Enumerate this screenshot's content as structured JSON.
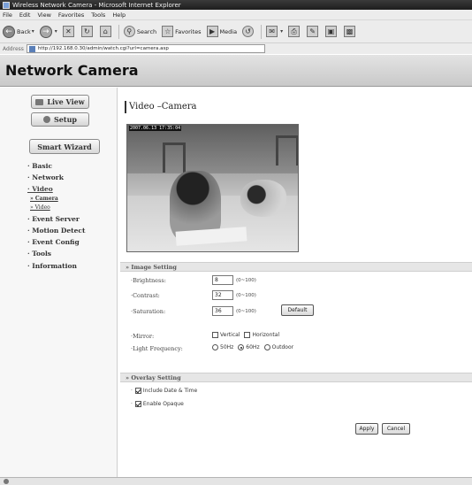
{
  "window": {
    "title": "Wireless Network Camera - Microsoft Internet Explorer"
  },
  "menu": [
    "File",
    "Edit",
    "View",
    "Favorites",
    "Tools",
    "Help"
  ],
  "toolbar": {
    "back_label": "Back",
    "search_label": "Search",
    "favorites_label": "Favorites",
    "media_label": "Media"
  },
  "address": {
    "label": "Address",
    "url": "http://192.168.0.30/admin/watch.cgi?url=camera.asp"
  },
  "header": {
    "brand": "Network Camera"
  },
  "sidebar": {
    "live_view": "Live View",
    "setup": "Setup",
    "smart_wizard": "Smart Wizard",
    "items": [
      {
        "label": "· Basic"
      },
      {
        "label": "· Network"
      },
      {
        "label": "· Video"
      },
      {
        "label": "» Camera"
      },
      {
        "label": "» Video"
      },
      {
        "label": "· Event Server"
      },
      {
        "label": "· Motion Detect"
      },
      {
        "label": "· Event Config"
      },
      {
        "label": "· Tools"
      },
      {
        "label": "· Information"
      }
    ]
  },
  "main": {
    "title": "Video –Camera",
    "timestamp": "2007.06.13 17:35:04",
    "image_setting": {
      "header": "» Image Setting",
      "brightness_label": "·Brightness:",
      "brightness_value": "8",
      "contrast_label": "·Contrast:",
      "contrast_value": "32",
      "saturation_label": "·Saturation:",
      "saturation_value": "36",
      "range_hint": "(0~100)",
      "default_button": "Default",
      "mirror_label": "·Mirror:",
      "mirror_options": [
        "Vertical",
        "Horizontal"
      ],
      "light_label": "·Light Frequency:",
      "light_options": [
        "50Hz",
        "60Hz",
        "Outdoor"
      ],
      "light_selected": "60Hz"
    },
    "overlay_setting": {
      "header": "» Overlay Setting",
      "include_date_time": "Include Date & Time",
      "enable_opaque": "Enable Opaque"
    },
    "apply_button": "Apply",
    "cancel_button": "Cancel"
  }
}
